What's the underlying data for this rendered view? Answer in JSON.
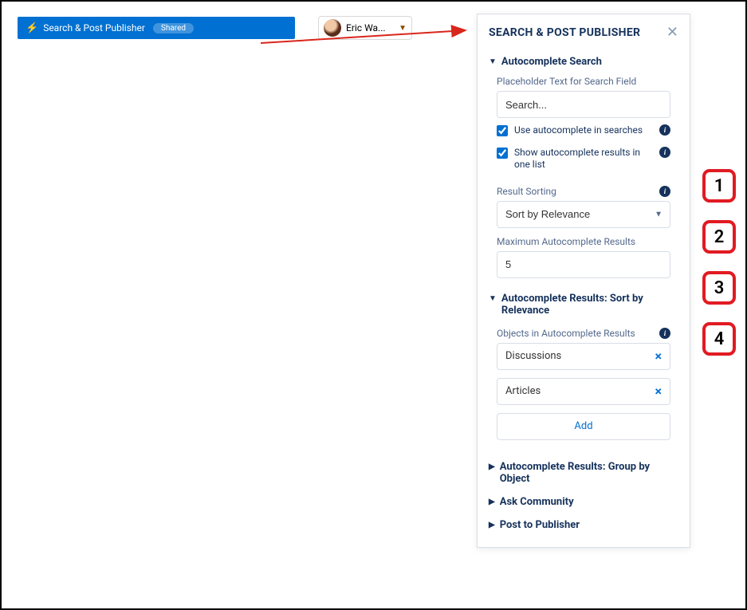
{
  "component": {
    "name": "Search & Post Publisher",
    "shared_badge": "Shared"
  },
  "user": {
    "display_name": "Eric Wa..."
  },
  "panel": {
    "title": "SEARCH & POST PUBLISHER",
    "sections": {
      "autocomplete_search": {
        "title": "Autocomplete Search",
        "placeholder_label": "Placeholder Text for Search Field",
        "placeholder_value": "Search...",
        "use_autocomplete_label": "Use autocomplete in searches",
        "show_one_list_label": "Show autocomplete results in one list",
        "result_sorting_label": "Result Sorting",
        "result_sorting_value": "Sort by Relevance",
        "max_results_label": "Maximum Autocomplete Results",
        "max_results_value": "5"
      },
      "sort_by_relevance": {
        "title": "Autocomplete Results: Sort by Relevance",
        "objects_label": "Objects in Autocomplete Results",
        "items": [
          "Discussions",
          "Articles"
        ],
        "add_label": "Add"
      },
      "group_by_object": {
        "title": "Autocomplete Results: Group by Object"
      },
      "ask_community": {
        "title": "Ask Community"
      },
      "post_to_publisher": {
        "title": "Post to Publisher"
      }
    }
  },
  "callouts": [
    "1",
    "2",
    "3",
    "4"
  ]
}
